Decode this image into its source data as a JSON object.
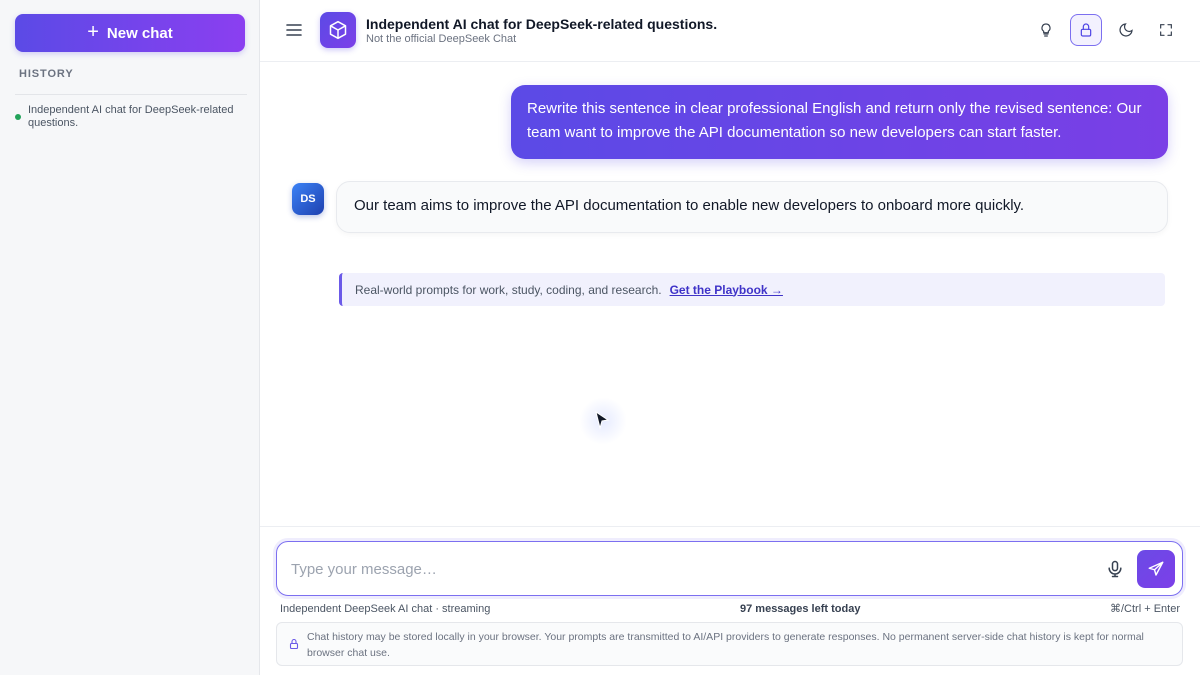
{
  "sidebar": {
    "new_chat_label": "New chat",
    "history_label": "HISTORY",
    "history_items": [
      {
        "label": "Independent AI chat for DeepSeek-related questions.",
        "status_color": "#22a35a"
      }
    ]
  },
  "header": {
    "title": "Independent AI chat for DeepSeek-related questions.",
    "subtitle": "Not the official DeepSeek Chat",
    "icons": [
      "lightbulb-icon",
      "lock-icon",
      "moon-icon",
      "fullscreen-icon"
    ],
    "active_icon": "lock-icon"
  },
  "messages": [
    {
      "role": "user",
      "text": "Rewrite this sentence in clear professional English and return only the revised sentence: Our team want to improve the API documentation so new developers can start faster."
    },
    {
      "role": "assistant",
      "avatar": "DS",
      "text": "Our team aims to improve the API documentation to enable new developers to onboard more quickly."
    }
  ],
  "promo": {
    "text": "Real-world prompts for work, study, coding, and research.",
    "link_label": "Get the Playbook →"
  },
  "composer": {
    "placeholder": "Type your message…",
    "value": ""
  },
  "status": {
    "left": "Independent DeepSeek AI chat · streaming",
    "center": "97 messages left today",
    "right": "⌘/Ctrl + Enter"
  },
  "privacy": {
    "text": "Chat history may be stored locally in your browser. Your prompts are transmitted to AI/API providers to generate responses. No permanent server-side chat history is kept for normal browser chat use."
  },
  "colors": {
    "accent": "#5b4ae6",
    "accent_end": "#8b3ff0",
    "avatar_blue": "#3b82f6"
  }
}
